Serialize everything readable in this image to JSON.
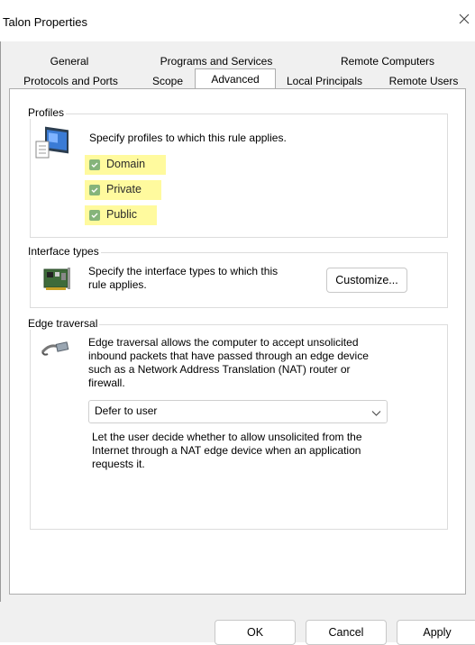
{
  "window": {
    "title": "Talon Properties"
  },
  "tabs_top": [
    "General",
    "Programs and Services",
    "Remote Computers"
  ],
  "tabs_bottom": [
    "Protocols and Ports",
    "Scope",
    "Advanced",
    "Local Principals",
    "Remote Users"
  ],
  "active_tab": "Advanced",
  "profiles": {
    "group_label": "Profiles",
    "description": "Specify profiles to which this rule applies.",
    "options": [
      {
        "label": "Domain",
        "checked": true
      },
      {
        "label": "Private",
        "checked": true
      },
      {
        "label": "Public",
        "checked": true
      }
    ],
    "highlight_color": "#fffa9e"
  },
  "interface_types": {
    "group_label": "Interface types",
    "description_line1": "Specify the interface types to which this",
    "description_line2": "rule applies.",
    "customize_label": "Customize..."
  },
  "edge_traversal": {
    "group_label": "Edge traversal",
    "description_lines": [
      "Edge traversal allows the computer to accept unsolicited",
      "inbound packets that have passed through an edge device",
      "such as a Network Address Translation (NAT) router or",
      "firewall."
    ],
    "selected_value": "Defer to user",
    "help_lines": [
      "Let the user decide whether to allow unsolicited from the",
      "Internet through a NAT edge device when an application",
      "requests it."
    ]
  },
  "buttons": {
    "ok": "OK",
    "cancel": "Cancel",
    "apply": "Apply"
  }
}
